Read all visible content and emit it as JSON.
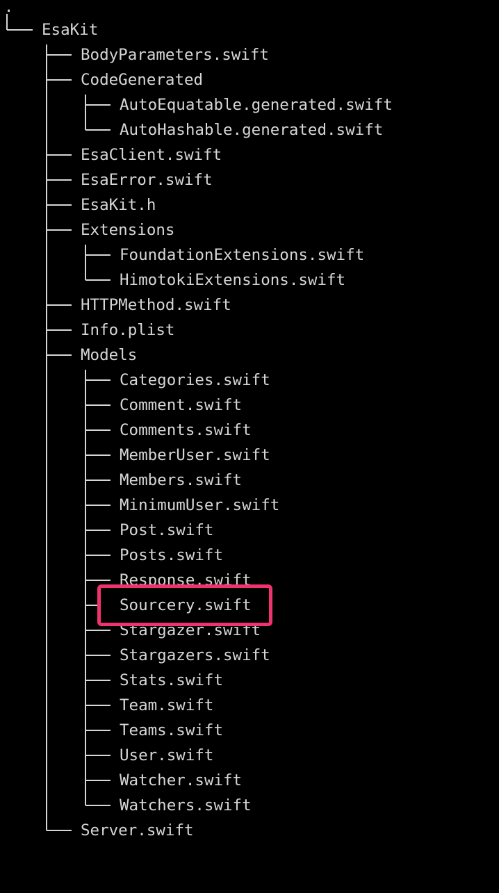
{
  "root": ".",
  "highlight_color": "#f0326e",
  "text_color": "#d6d6d6",
  "background_color": "#000000",
  "tree": {
    "esakit": "EsaKit",
    "body_parameters": "BodyParameters.swift",
    "code_generated": "CodeGenerated",
    "auto_equatable": "AutoEquatable.generated.swift",
    "auto_hashable": "AutoHashable.generated.swift",
    "esa_client": "EsaClient.swift",
    "esa_error": "EsaError.swift",
    "esakit_h": "EsaKit.h",
    "extensions": "Extensions",
    "foundation_extensions": "FoundationExtensions.swift",
    "himotoki_extensions": "HimotokiExtensions.swift",
    "http_method": "HTTPMethod.swift",
    "info_plist": "Info.plist",
    "models": "Models",
    "categories": "Categories.swift",
    "comment": "Comment.swift",
    "comments": "Comments.swift",
    "member_user": "MemberUser.swift",
    "members": "Members.swift",
    "minimum_user": "MinimumUser.swift",
    "post": "Post.swift",
    "posts": "Posts.swift",
    "response": "Response.swift",
    "sourcery": "Sourcery.swift",
    "stargazer": "Stargazer.swift",
    "stargazers": "Stargazers.swift",
    "stats": "Stats.swift",
    "team": "Team.swift",
    "teams": "Teams.swift",
    "user": "User.swift",
    "watcher": "Watcher.swift",
    "watchers": "Watchers.swift",
    "server": "Server.swift"
  }
}
